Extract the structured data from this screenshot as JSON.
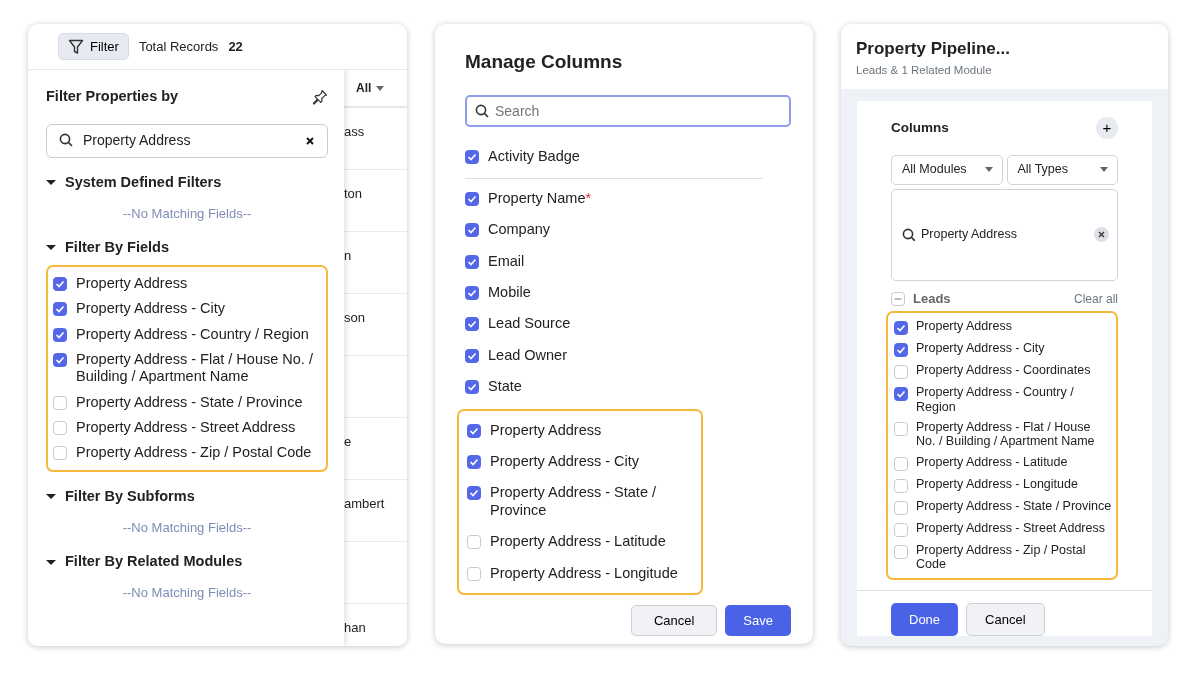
{
  "filter_panel": {
    "filter_button": "Filter",
    "total_label": "Total Records",
    "total_count": "22",
    "title": "Filter Properties by",
    "search_value": "Property Address",
    "sections": [
      {
        "title": "System Defined Filters",
        "expanded": true,
        "empty_text": "--No Matching Fields--"
      },
      {
        "title": "Filter By Fields",
        "expanded": true,
        "items": [
          {
            "label": "Property Address",
            "checked": true
          },
          {
            "label": "Property Address - City",
            "checked": true
          },
          {
            "label": "Property Address - Country / Region",
            "checked": true
          },
          {
            "label": "Property Address - Flat / House No. / Building / Apartment Name",
            "checked": true
          },
          {
            "label": "Property Address - State / Province",
            "checked": false
          },
          {
            "label": "Property Address - Street Address",
            "checked": false
          },
          {
            "label": "Property Address - Zip / Postal Code",
            "checked": false
          }
        ]
      },
      {
        "title": "Filter By Subforms",
        "expanded": true,
        "empty_text": "--No Matching Fields--"
      },
      {
        "title": "Filter By Related Modules",
        "expanded": true,
        "empty_text": "--No Matching Fields--"
      }
    ],
    "table_header": "All",
    "table_cells": [
      "ass",
      "ton",
      "n",
      "son",
      "",
      "e",
      "ambert",
      "",
      "han"
    ]
  },
  "manage_columns": {
    "title": "Manage Columns",
    "search_placeholder": "Search",
    "top_columns": [
      {
        "label": "Activity Badge",
        "checked": true
      }
    ],
    "columns": [
      {
        "label": "Property Name",
        "checked": true,
        "required_mark": "*"
      },
      {
        "label": "Company",
        "checked": true
      },
      {
        "label": "Email",
        "checked": true
      },
      {
        "label": "Mobile",
        "checked": true
      },
      {
        "label": "Lead Source",
        "checked": true
      },
      {
        "label": "Lead Owner",
        "checked": true
      },
      {
        "label": "State",
        "checked": true
      }
    ],
    "highlighted_columns": [
      {
        "label": "Property Address",
        "checked": true
      },
      {
        "label": "Property Address - City",
        "checked": true
      },
      {
        "label": "Property Address - State / Province",
        "checked": true
      },
      {
        "label": "Property Address - Latitude",
        "checked": false
      },
      {
        "label": "Property Address - Longitude",
        "checked": false
      }
    ],
    "buttons": [
      "Cancel",
      "Save"
    ]
  },
  "pipeline": {
    "title": "Property Pipeline...",
    "subtitle": "Leads & 1 Related Module",
    "columns_title": "Columns",
    "add_symbol": "+",
    "module_select": "All Modules",
    "type_select": "All Types",
    "search_value": "Property Address",
    "group_label": "Leads",
    "group_checked": false,
    "group_indeterminate": true,
    "clear_all": "Clear all",
    "items": [
      {
        "label": "Property Address",
        "checked": true
      },
      {
        "label": "Property Address - City",
        "checked": true
      },
      {
        "label": "Property Address - Coordinates",
        "checked": false
      },
      {
        "label": "Property Address - Country / Region",
        "checked": true
      },
      {
        "label": "Property Address - Flat / House No. / Building / Apartment Name",
        "checked": false
      },
      {
        "label": "Property Address - Latitude",
        "checked": false
      },
      {
        "label": "Property Address - Longitude",
        "checked": false
      },
      {
        "label": "Property Address - State / Province",
        "checked": false
      },
      {
        "label": "Property Address - Street Address",
        "checked": false
      },
      {
        "label": "Property Address - Zip / Postal Code",
        "checked": false
      }
    ],
    "buttons": [
      "Done",
      "Cancel"
    ]
  }
}
